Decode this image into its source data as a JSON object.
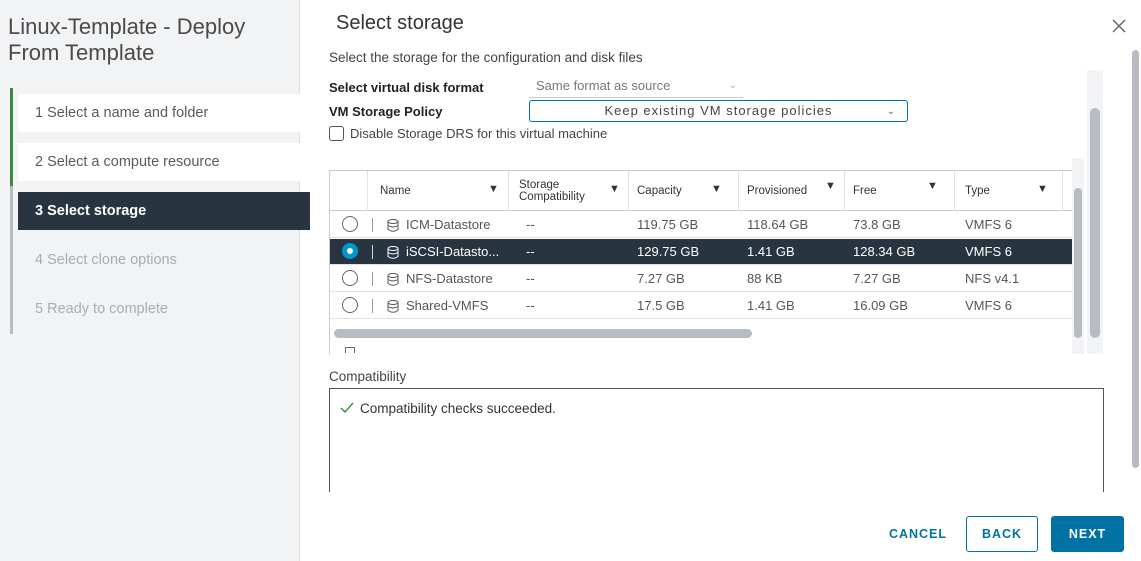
{
  "wizard": {
    "title": "Linux-Template - Deploy From Template",
    "steps": [
      {
        "label": "1  Select a name and folder"
      },
      {
        "label": "2  Select a compute resource"
      },
      {
        "label": "3  Select storage"
      },
      {
        "label": "4  Select clone options"
      },
      {
        "label": "5  Ready to complete"
      }
    ],
    "active_step": 3
  },
  "page": {
    "title": "Select storage",
    "subtitle": "Select the storage for the configuration and disk files",
    "close_icon": "close-icon"
  },
  "form": {
    "disk_format_label": "Select virtual disk format",
    "disk_format_value": "Same format as source",
    "policy_label": "VM Storage Policy",
    "policy_value": "Keep existing VM storage policies",
    "drs_label": "Disable Storage DRS for this virtual machine",
    "drs_checked": false
  },
  "grid": {
    "columns": [
      {
        "label": "Name"
      },
      {
        "label": "Storage Compatibility"
      },
      {
        "label": "Capacity"
      },
      {
        "label": "Provisioned"
      },
      {
        "label": "Free"
      },
      {
        "label": "Type"
      }
    ],
    "rows": [
      {
        "name": "ICM-Datastore",
        "compat": "--",
        "capacity": "119.75 GB",
        "provisioned": "118.64 GB",
        "free": "73.8 GB",
        "type": "VMFS 6",
        "selected": false
      },
      {
        "name": "iSCSI-Datasto...",
        "compat": "--",
        "capacity": "129.75 GB",
        "provisioned": "1.41 GB",
        "free": "128.34 GB",
        "type": "VMFS 6",
        "selected": true
      },
      {
        "name": "NFS-Datastore",
        "compat": "--",
        "capacity": "7.27 GB",
        "provisioned": "88 KB",
        "free": "7.27 GB",
        "type": "NFS v4.1",
        "selected": false
      },
      {
        "name": "Shared-VMFS",
        "compat": "--",
        "capacity": "17.5 GB",
        "provisioned": "1.41 GB",
        "free": "16.09 GB",
        "type": "VMFS 6",
        "selected": false
      }
    ]
  },
  "compatibility": {
    "label": "Compatibility",
    "message": "Compatibility checks succeeded."
  },
  "footer": {
    "cancel_label": "CANCEL",
    "back_label": "BACK",
    "next_label": "NEXT"
  },
  "colors": {
    "accent": "#0072a3",
    "selected_row": "#283540",
    "success": "#3f8a3f"
  }
}
